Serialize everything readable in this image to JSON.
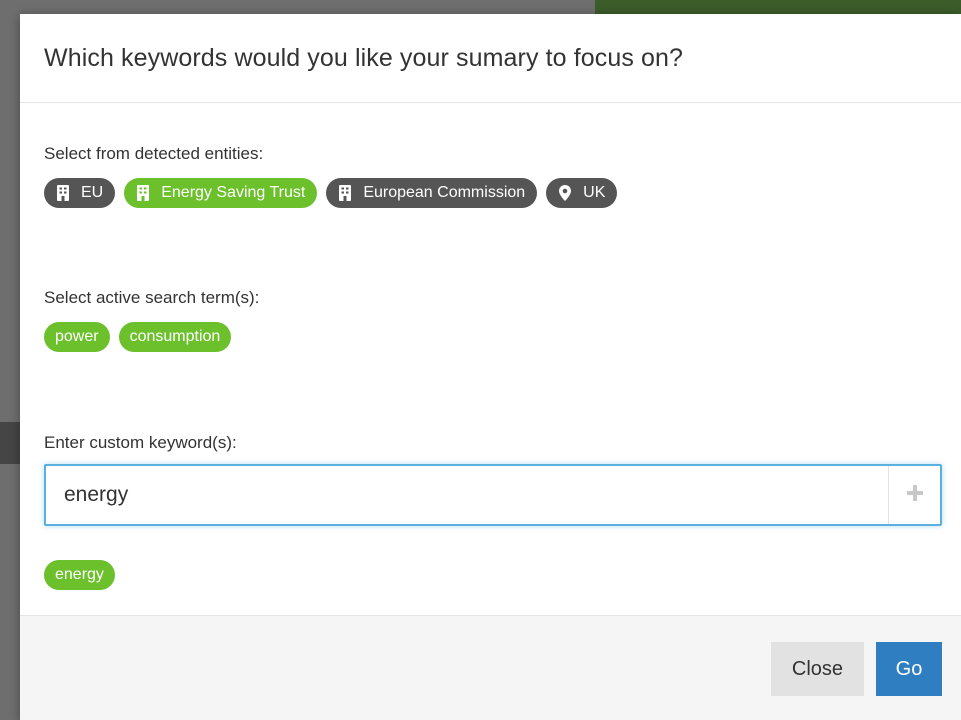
{
  "modal": {
    "title": "Which keywords would you like your sumary to focus on?"
  },
  "entities": {
    "label": "Select from detected entities:",
    "items": [
      {
        "label": "EU",
        "icon": "building-icon",
        "selected": false
      },
      {
        "label": "Energy Saving Trust",
        "icon": "building-icon",
        "selected": true
      },
      {
        "label": "European Commission",
        "icon": "building-icon",
        "selected": false
      },
      {
        "label": "UK",
        "icon": "map-marker-icon",
        "selected": false
      }
    ]
  },
  "search_terms": {
    "label": "Select active search term(s):",
    "items": [
      "power",
      "consumption"
    ]
  },
  "custom": {
    "label": "Enter custom keyword(s):",
    "input_value": "energy",
    "add_icon": "plus-icon",
    "keywords": [
      "energy"
    ]
  },
  "footer": {
    "close_label": "Close",
    "go_label": "Go"
  },
  "colors": {
    "accent_green": "#6cc02c",
    "entity_gray": "#555555",
    "primary_blue": "#2f7ec1",
    "focus_blue": "#5bb0df"
  }
}
